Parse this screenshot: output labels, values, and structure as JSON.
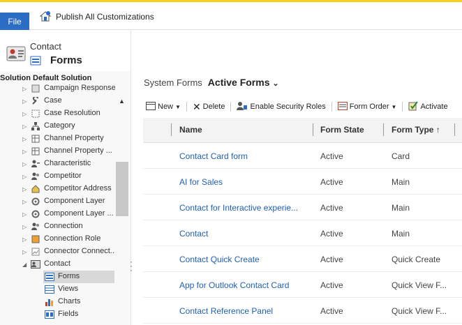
{
  "ribbon": {
    "file_label": "File",
    "publish_label": "Publish All Customizations"
  },
  "entity": {
    "name": "Contact",
    "section_title": "Forms"
  },
  "solution": {
    "label": "Solution Default Solution"
  },
  "tree": {
    "items": [
      {
        "label": "Campaign Response",
        "icon": "campaign-response-icon"
      },
      {
        "label": "Case",
        "icon": "wrench-icon"
      },
      {
        "label": "Case Resolution",
        "icon": "case-resolution-icon"
      },
      {
        "label": "Category",
        "icon": "hierarchy-icon"
      },
      {
        "label": "Channel Property",
        "icon": "grid-icon"
      },
      {
        "label": "Channel Property ...",
        "icon": "grid-icon"
      },
      {
        "label": "Characteristic",
        "icon": "characteristic-icon"
      },
      {
        "label": "Competitor",
        "icon": "people-icon"
      },
      {
        "label": "Competitor Address",
        "icon": "address-icon"
      },
      {
        "label": "Component Layer",
        "icon": "layers-icon"
      },
      {
        "label": "Component Layer ...",
        "icon": "layers-icon"
      },
      {
        "label": "Connection",
        "icon": "people-icon"
      },
      {
        "label": "Connection Role",
        "icon": "connection-role-icon"
      },
      {
        "label": "Connector Connect...",
        "icon": "broken-image-icon"
      },
      {
        "label": "Contact",
        "icon": "contact-card-icon"
      }
    ],
    "sub_items": [
      {
        "label": "Forms",
        "icon": "form-icon",
        "selected": true
      },
      {
        "label": "Views",
        "icon": "view-icon",
        "selected": false
      },
      {
        "label": "Charts",
        "icon": "chart-icon",
        "selected": false
      },
      {
        "label": "Fields",
        "icon": "fields-icon",
        "selected": false
      }
    ]
  },
  "main": {
    "crumb_system": "System Forms",
    "crumb_view": "Active Forms"
  },
  "toolbar": {
    "new_label": "New",
    "delete_label": "Delete",
    "roles_label": "Enable Security Roles",
    "order_label": "Form Order",
    "activate_label": "Activate"
  },
  "grid": {
    "columns": {
      "name": "Name",
      "state": "Form State",
      "type": "Form Type"
    },
    "sort_indicator": "↑",
    "rows": [
      {
        "name": "Contact Card form",
        "state": "Active",
        "type": "Card"
      },
      {
        "name": "AI for Sales",
        "state": "Active",
        "type": "Main"
      },
      {
        "name": "Contact for Interactive experie...",
        "state": "Active",
        "type": "Main"
      },
      {
        "name": "Contact",
        "state": "Active",
        "type": "Main"
      },
      {
        "name": "Contact Quick Create",
        "state": "Active",
        "type": "Quick Create"
      },
      {
        "name": "App for Outlook Contact Card",
        "state": "Active",
        "type": "Quick View F..."
      },
      {
        "name": "Contact Reference Panel",
        "state": "Active",
        "type": "Quick View F..."
      }
    ]
  },
  "colors": {
    "accent": "#2b6cc4",
    "link": "#1f5fb4",
    "topline": "#f4d21a",
    "selected": "#d8d8d8"
  }
}
